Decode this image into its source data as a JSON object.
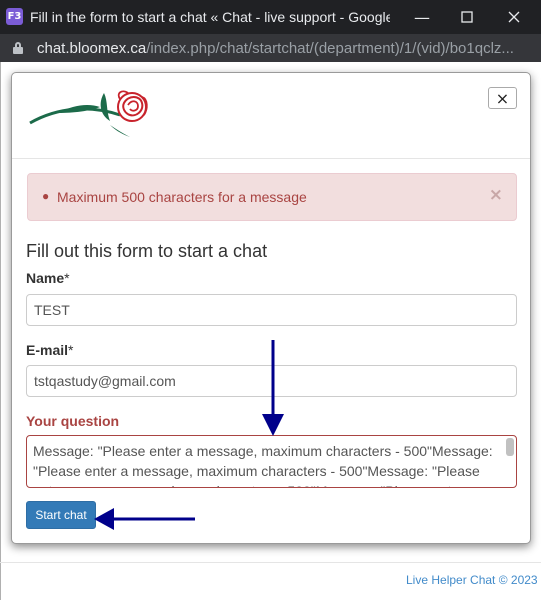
{
  "window": {
    "title": "Fill in the form to start a chat « Chat - live support - Google Chr...",
    "app_icon_label": "F3"
  },
  "address_bar": {
    "host": "chat.bloomex.ca",
    "path": "/index.php/chat/startchat/(department)/1/(vid)/bo1qclz..."
  },
  "modal": {
    "close_label": "×",
    "alert": {
      "message": "Maximum 500 characters for a message",
      "close_label": "×"
    },
    "form_title": "Fill out this form to start a chat",
    "name": {
      "label": "Name",
      "required_mark": "*",
      "value": "TEST"
    },
    "email": {
      "label": "E-mail",
      "required_mark": "*",
      "value": "tstqastudy@gmail.com"
    },
    "question": {
      "label": "Your question",
      "value": "Message: \"Please enter a message, maximum characters - 500\"Message: \"Please enter a message, maximum characters - 500\"Message: \"Please enter a message, maximum characters - 500\"Message: \"Please enter"
    },
    "start_button_label": "Start chat"
  },
  "footer": {
    "text": "Live Helper Chat © 2023"
  },
  "colors": {
    "titlebar": "#202124",
    "addressbar": "#35363a",
    "alert_bg": "#f2dede",
    "alert_text": "#a94442",
    "primary_button": "#337ab7",
    "annotation_arrow": "#00008b",
    "footer_link": "#428bca"
  },
  "icons": {
    "window_minimize": "minimize-icon",
    "window_maximize": "maximize-icon",
    "window_close": "close-icon",
    "lock": "lock-icon",
    "logo": "rose-logo"
  }
}
